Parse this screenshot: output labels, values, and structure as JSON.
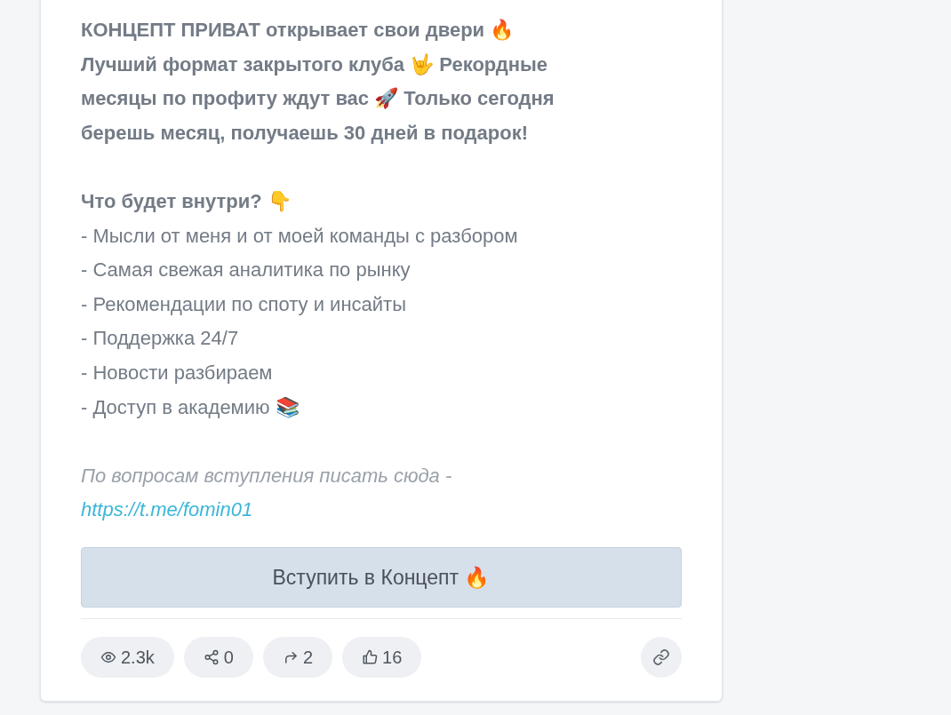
{
  "post": {
    "intro_lines": [
      "КОНЦЕПТ ПРИВАТ открывает свои двери 🔥",
      "Лучший формат закрытого клуба 🤟 Рекордные",
      "месяцы по профиту ждут вас 🚀 Только сегодня",
      "берешь месяц, получаешь 30 дней в подарок!"
    ],
    "list_heading": "Что будет внутри? 👇",
    "list_items": [
      "- Мысли от меня и от моей команды с разбором",
      "- Самая свежая аналитика по рынку",
      "- Рекомендации по споту и инсайты",
      "- Поддержка 24/7",
      "- Новости разбираем",
      "- Доступ в академию 📚"
    ],
    "contact_note": "По вопросам вступления писать сюда -",
    "contact_link": "https://t.me/fomin01",
    "join_button": "Вступить в Концепт 🔥",
    "stats": [
      {
        "kind": "views",
        "value": "2.3k"
      },
      {
        "kind": "shares",
        "value": "0"
      },
      {
        "kind": "forwards",
        "value": "2"
      },
      {
        "kind": "likes",
        "value": "16"
      }
    ]
  }
}
